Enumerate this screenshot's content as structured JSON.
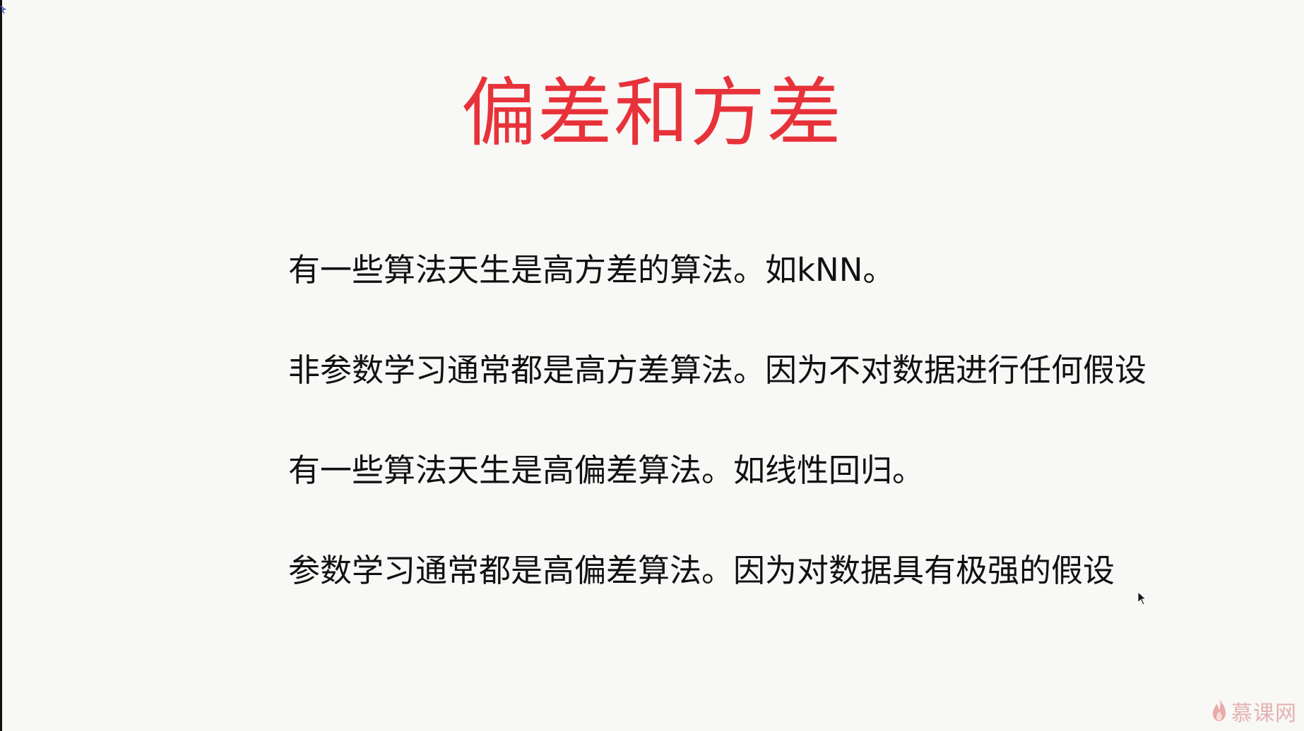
{
  "slide": {
    "title": "偏差和方差",
    "lines": [
      "有一些算法天生是高方差的算法。如kNN。",
      "非参数学习通常都是高方差算法。因为不对数据进行任何假设",
      "有一些算法天生是高偏差算法。如线性回归。",
      "参数学习通常都是高偏差算法。因为对数据具有极强的假设"
    ]
  },
  "watermark": {
    "logo": "flame-logo",
    "text": "慕课网"
  },
  "colors": {
    "title": "#e8323a",
    "text": "#111111",
    "background": "#f8f8f6"
  }
}
